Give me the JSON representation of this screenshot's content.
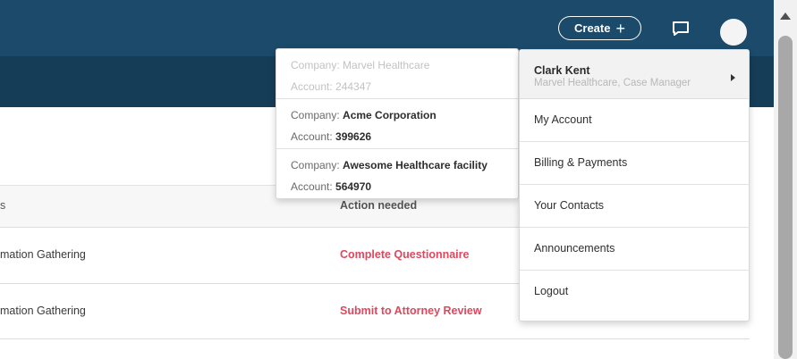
{
  "header": {
    "create_label": "Create",
    "create_icon": "plus-icon",
    "chat_icon": "chat-bubble-icon",
    "avatar_icon": "user-avatar-icon"
  },
  "table": {
    "header": {
      "col1": "s",
      "col2": "Action needed"
    },
    "rows": [
      {
        "col1": "mation Gathering",
        "col2": "Complete Questionnaire"
      },
      {
        "col1": "mation Gathering",
        "col2": "Submit to Attorney Review"
      }
    ]
  },
  "account_switcher": {
    "company_prefix": "Company: ",
    "account_prefix": "Account: ",
    "accounts": [
      {
        "company": "Marvel Healthcare",
        "account": "244347",
        "current": true
      },
      {
        "company": "Acme Corporation",
        "account": "399626",
        "current": false
      },
      {
        "company": "Awesome Healthcare facility",
        "account": "564970",
        "current": false
      }
    ]
  },
  "user_menu": {
    "name": "Clark Kent",
    "role": "Marvel Healthcare, Case Manager",
    "items": [
      "My Account",
      "Billing & Payments",
      "Your Contacts",
      "Announcements",
      "Logout"
    ]
  },
  "colors": {
    "header_bg": "#1b4a6b",
    "subheader_bg": "#153d58",
    "action_link": "#e0475d"
  }
}
